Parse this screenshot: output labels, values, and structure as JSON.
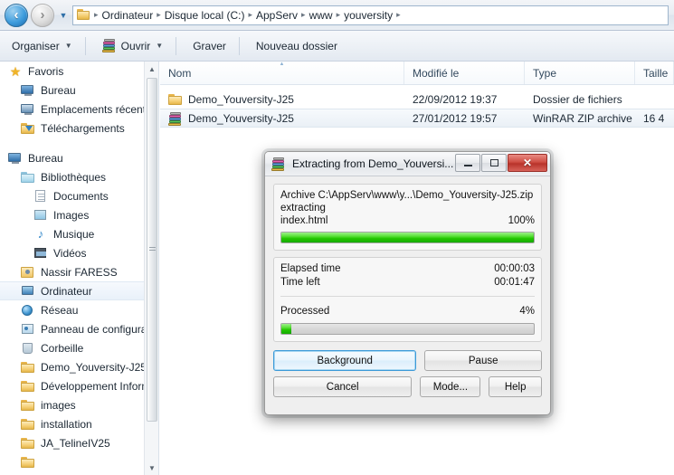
{
  "window": {
    "address_bar": {
      "back_icon": "back-arrow-icon",
      "forward_icon": "forward-arrow-icon",
      "history_icon": "chevron-down-icon",
      "folder_icon": "folder-icon",
      "separator": "▸",
      "crumbs": [
        "Ordinateur",
        "Disque local (C:)",
        "AppServ",
        "www",
        "youversity"
      ]
    },
    "toolbar": {
      "organiser_label": "Organiser",
      "ouvrir_label": "Ouvrir",
      "ouvrir_icon": "winrar-icon",
      "graver_label": "Graver",
      "nouveau_dossier_label": "Nouveau dossier",
      "caret": "▼"
    }
  },
  "navpane": {
    "items": [
      {
        "label": "Favoris",
        "icon": "star-icon",
        "indent": 1,
        "selected": false
      },
      {
        "label": "Bureau",
        "icon": "monitor-icon",
        "indent": 2,
        "selected": false
      },
      {
        "label": "Emplacements récents",
        "icon": "recent-places-icon",
        "indent": 2,
        "selected": false
      },
      {
        "label": "Téléchargements",
        "icon": "downloads-icon",
        "indent": 2,
        "selected": false
      },
      {
        "label": "Bureau",
        "icon": "monitor-icon",
        "indent": 1,
        "selected": false
      },
      {
        "label": "Bibliothèques",
        "icon": "libraries-folder-icon",
        "indent": 2,
        "selected": false
      },
      {
        "label": "Documents",
        "icon": "document-icon",
        "indent": 3,
        "selected": false
      },
      {
        "label": "Images",
        "icon": "picture-icon",
        "indent": 3,
        "selected": false
      },
      {
        "label": "Musique",
        "icon": "music-note-icon",
        "indent": 3,
        "selected": false
      },
      {
        "label": "Vidéos",
        "icon": "video-icon",
        "indent": 3,
        "selected": false
      },
      {
        "label": "Nassir FARESS",
        "icon": "user-folder-icon",
        "indent": 2,
        "selected": false
      },
      {
        "label": "Ordinateur",
        "icon": "computer-icon",
        "indent": 2,
        "selected": true
      },
      {
        "label": "Réseau",
        "icon": "network-icon",
        "indent": 2,
        "selected": false
      },
      {
        "label": "Panneau de configuratio",
        "icon": "control-panel-icon",
        "indent": 2,
        "selected": false
      },
      {
        "label": "Corbeille",
        "icon": "recycle-bin-icon",
        "indent": 2,
        "selected": false
      },
      {
        "label": "Demo_Youversity-J25",
        "icon": "folder-icon",
        "indent": 2,
        "selected": false
      },
      {
        "label": "Développement Informa",
        "icon": "folder-icon",
        "indent": 2,
        "selected": false
      },
      {
        "label": "images",
        "icon": "folder-icon",
        "indent": 2,
        "selected": false
      },
      {
        "label": "installation",
        "icon": "folder-icon",
        "indent": 2,
        "selected": false
      },
      {
        "label": "JA_TelineIV25",
        "icon": "folder-icon",
        "indent": 2,
        "selected": false
      }
    ],
    "scrollbar": {
      "up_arrow": "▲",
      "down_arrow": "▼"
    }
  },
  "filelist": {
    "columns": [
      {
        "label": "Nom",
        "sorted": true
      },
      {
        "label": "Modifié le",
        "sorted": false
      },
      {
        "label": "Type",
        "sorted": false
      },
      {
        "label": "Taille",
        "sorted": false
      }
    ],
    "rows": [
      {
        "name": "Demo_Youversity-J25",
        "modified": "22/09/2012 19:37",
        "type": "Dossier de fichiers",
        "size": "",
        "icon": "folder-icon",
        "selected": false
      },
      {
        "name": "Demo_Youversity-J25",
        "modified": "27/01/2012 19:57",
        "type": "WinRAR ZIP archive",
        "size": "16 4",
        "icon": "winrar-icon",
        "selected": true
      }
    ]
  },
  "dialog": {
    "title": "Extracting from Demo_Youversi...",
    "title_icon": "winrar-icon",
    "window_buttons": {
      "minimize": "minimize-icon",
      "maximize": "maximize-icon",
      "close": "✕"
    },
    "archive_line": "Archive C:\\AppServ\\www\\y...\\Demo_Youversity-J25.zip",
    "operation_line": "extracting",
    "current_file": "index.html",
    "current_percent": "100%",
    "current_progress_value": 100,
    "elapsed_label": "Elapsed time",
    "elapsed_value": "00:00:03",
    "timeleft_label": "Time left",
    "timeleft_value": "00:01:47",
    "processed_label": "Processed",
    "processed_percent": "4%",
    "processed_progress_value": 4,
    "buttons": {
      "background": "Background",
      "pause": "Pause",
      "cancel": "Cancel",
      "mode": "Mode...",
      "help": "Help"
    },
    "colors": {
      "progress_green": "#22c700",
      "close_red": "#cf4e44",
      "focus_blue": "#3c9ad8"
    }
  }
}
